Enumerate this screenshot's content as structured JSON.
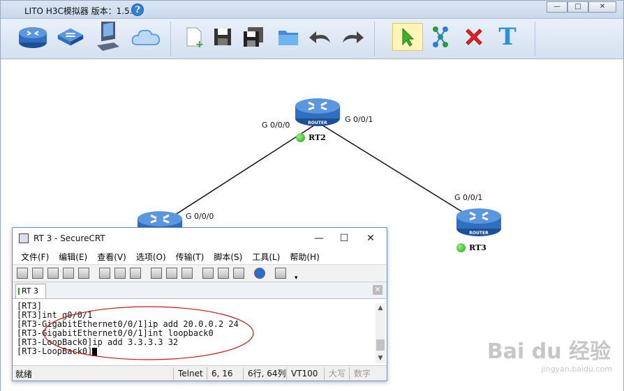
{
  "app": {
    "title": "LITO H3C模拟器 版本：1.5.2",
    "help_icon": "?",
    "win_buttons": [
      "—",
      "□",
      "✕"
    ]
  },
  "toolbar": {
    "items": [
      {
        "name": "router-tool",
        "icon": "router-icon"
      },
      {
        "name": "switch-tool",
        "icon": "switch-icon"
      },
      {
        "name": "pc-tool",
        "icon": "pc-icon"
      },
      {
        "name": "cloud-tool",
        "icon": "cloud-icon"
      },
      {
        "name": "new-file",
        "icon": "new-file-icon"
      },
      {
        "name": "save",
        "icon": "save-icon"
      },
      {
        "name": "save-as",
        "icon": "save-as-icon"
      },
      {
        "name": "open",
        "icon": "folder-icon"
      },
      {
        "name": "undo",
        "icon": "undo-icon"
      },
      {
        "name": "redo",
        "icon": "redo-icon"
      },
      {
        "name": "select",
        "icon": "pointer-icon",
        "active": true
      },
      {
        "name": "connect",
        "icon": "connect-icon"
      },
      {
        "name": "delete",
        "icon": "delete-icon"
      },
      {
        "name": "text",
        "icon": "text-icon",
        "label": "T"
      }
    ]
  },
  "topology": {
    "router_label": "ROUTER",
    "nodes": [
      {
        "id": "RT2",
        "label": "RT2"
      },
      {
        "id": "RT3",
        "label": "RT3"
      },
      {
        "id": "RT1",
        "label": ""
      }
    ],
    "interfaces": {
      "rt2_left": "G 0/0/0",
      "rt2_right": "G 0/0/1",
      "rt3_top": "G 0/0/1",
      "rt1_right": "G 0/0/0"
    }
  },
  "securecrt": {
    "title": "RT 3 - SecureCRT",
    "controls": [
      "—",
      "☐",
      "✕"
    ],
    "menu": [
      "文件(F)",
      "编辑(E)",
      "查看(V)",
      "选项(O)",
      "传输(T)",
      "脚本(S)",
      "工具(L)",
      "帮助(H)"
    ],
    "tab_label": "RT 3",
    "tab_close": "✕",
    "terminal_lines": [
      "[RT3]",
      "[RT3]int g0/0/1",
      "[RT3-GigabitEthernet0/0/1]ip add 20.0.0.2 24",
      "[RT3-GigabitEthernet0/0/1]int loopback0",
      "[RT3-LoopBack0]ip add 3.3.3.3 32",
      "[RT3-LoopBack0]"
    ],
    "status": {
      "ready": "就绪",
      "protocol": "Telnet",
      "cursor_pos": "6,  16",
      "rows_cols": "6行, 64列",
      "term_type": "VT100",
      "caps": "大写",
      "num": "数字"
    }
  },
  "watermark": {
    "text": "Bai du 经验",
    "url": "jingyan.baidu.com"
  },
  "colors": {
    "router_blue": "#2f6fc0",
    "status_green": "#3cb82a",
    "annotation_red": "#c01818"
  }
}
